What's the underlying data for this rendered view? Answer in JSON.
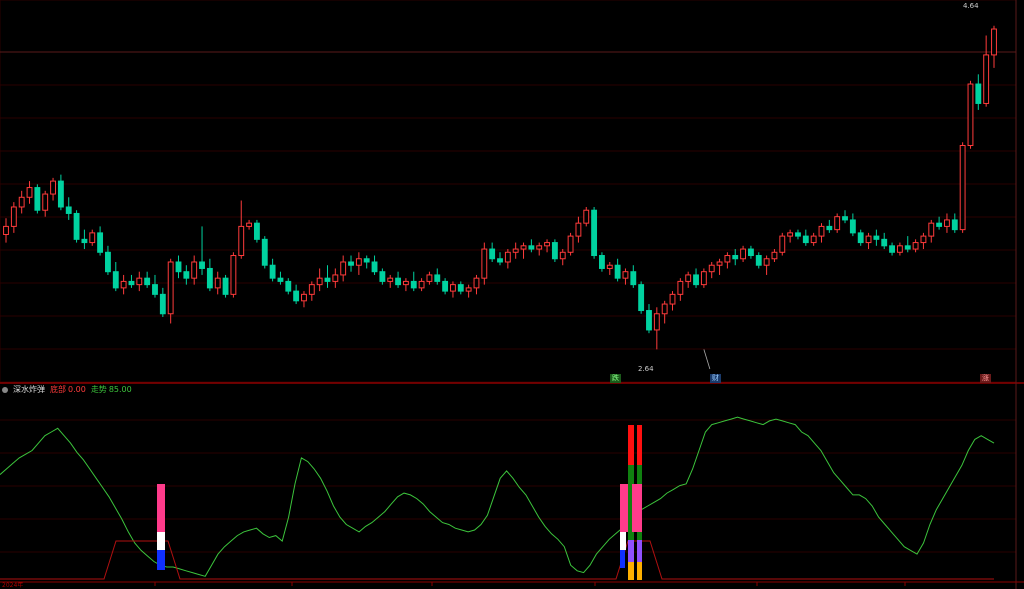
{
  "indicator": {
    "name": "深水炸弹",
    "param1_label": "底部",
    "param1_value": "0.00",
    "param2_label": "走势",
    "param2_value": "85.00"
  },
  "markers": {
    "die": "跌",
    "cai": "财",
    "zhang": "涨"
  },
  "x_axis_label": "2024年",
  "colors": {
    "up": "#ff3b3b",
    "down": "#00d2a0",
    "indicator_line": "#3cc43c",
    "panel_line": "#8b0000"
  },
  "chart_data": [
    {
      "type": "candlestick",
      "title": "",
      "annotations": [
        {
          "label": "4.64",
          "value": 4.64,
          "bar_index": 140
        },
        {
          "label": "2.64",
          "value": 2.64,
          "bar_index": 89
        }
      ],
      "ylim": [
        2.5,
        4.75
      ],
      "candles": [
        [
          3.35,
          3.45,
          3.3,
          3.4
        ],
        [
          3.4,
          3.55,
          3.36,
          3.52
        ],
        [
          3.52,
          3.62,
          3.48,
          3.58
        ],
        [
          3.58,
          3.68,
          3.54,
          3.64
        ],
        [
          3.64,
          3.66,
          3.48,
          3.5
        ],
        [
          3.5,
          3.62,
          3.46,
          3.6
        ],
        [
          3.6,
          3.7,
          3.56,
          3.68
        ],
        [
          3.68,
          3.72,
          3.5,
          3.52
        ],
        [
          3.52,
          3.58,
          3.44,
          3.48
        ],
        [
          3.48,
          3.5,
          3.3,
          3.32
        ],
        [
          3.32,
          3.38,
          3.26,
          3.3
        ],
        [
          3.3,
          3.38,
          3.28,
          3.36
        ],
        [
          3.36,
          3.4,
          3.22,
          3.24
        ],
        [
          3.24,
          3.28,
          3.1,
          3.12
        ],
        [
          3.12,
          3.18,
          3.0,
          3.02
        ],
        [
          3.02,
          3.1,
          2.98,
          3.06
        ],
        [
          3.06,
          3.1,
          3.02,
          3.04
        ],
        [
          3.04,
          3.12,
          3.0,
          3.08
        ],
        [
          3.08,
          3.12,
          3.02,
          3.04
        ],
        [
          3.04,
          3.1,
          2.96,
          2.98
        ],
        [
          2.98,
          3.02,
          2.84,
          2.86
        ],
        [
          2.86,
          3.2,
          2.8,
          3.18
        ],
        [
          3.18,
          3.22,
          3.08,
          3.12
        ],
        [
          3.12,
          3.16,
          3.04,
          3.08
        ],
        [
          3.08,
          3.22,
          3.04,
          3.18
        ],
        [
          3.18,
          3.4,
          3.1,
          3.14
        ],
        [
          3.14,
          3.2,
          3.0,
          3.02
        ],
        [
          3.02,
          3.12,
          2.98,
          3.08
        ],
        [
          3.08,
          3.1,
          2.96,
          2.98
        ],
        [
          2.98,
          3.24,
          2.96,
          3.22
        ],
        [
          3.22,
          3.56,
          3.2,
          3.4
        ],
        [
          3.4,
          3.44,
          3.38,
          3.42
        ],
        [
          3.42,
          3.44,
          3.3,
          3.32
        ],
        [
          3.32,
          3.34,
          3.14,
          3.16
        ],
        [
          3.16,
          3.2,
          3.06,
          3.08
        ],
        [
          3.08,
          3.12,
          3.04,
          3.06
        ],
        [
          3.06,
          3.08,
          2.98,
          3.0
        ],
        [
          3.0,
          3.04,
          2.92,
          2.94
        ],
        [
          2.94,
          3.0,
          2.9,
          2.98
        ],
        [
          2.98,
          3.06,
          2.94,
          3.04
        ],
        [
          3.04,
          3.14,
          3.0,
          3.08
        ],
        [
          3.08,
          3.16,
          3.02,
          3.06
        ],
        [
          3.06,
          3.14,
          3.02,
          3.1
        ],
        [
          3.1,
          3.22,
          3.06,
          3.18
        ],
        [
          3.18,
          3.22,
          3.12,
          3.16
        ],
        [
          3.16,
          3.24,
          3.1,
          3.2
        ],
        [
          3.2,
          3.22,
          3.14,
          3.18
        ],
        [
          3.18,
          3.22,
          3.1,
          3.12
        ],
        [
          3.12,
          3.14,
          3.04,
          3.06
        ],
        [
          3.06,
          3.1,
          3.02,
          3.08
        ],
        [
          3.08,
          3.12,
          3.02,
          3.04
        ],
        [
          3.04,
          3.08,
          3.0,
          3.06
        ],
        [
          3.06,
          3.12,
          3.0,
          3.02
        ],
        [
          3.02,
          3.08,
          3.0,
          3.06
        ],
        [
          3.06,
          3.12,
          3.04,
          3.1
        ],
        [
          3.1,
          3.14,
          3.04,
          3.06
        ],
        [
          3.06,
          3.08,
          2.98,
          3.0
        ],
        [
          3.0,
          3.06,
          2.96,
          3.04
        ],
        [
          3.04,
          3.06,
          2.98,
          3.0
        ],
        [
          3.0,
          3.04,
          2.96,
          3.02
        ],
        [
          3.02,
          3.1,
          2.98,
          3.08
        ],
        [
          3.08,
          3.3,
          3.04,
          3.26
        ],
        [
          3.26,
          3.3,
          3.18,
          3.2
        ],
        [
          3.2,
          3.24,
          3.16,
          3.18
        ],
        [
          3.18,
          3.26,
          3.14,
          3.24
        ],
        [
          3.24,
          3.3,
          3.2,
          3.26
        ],
        [
          3.26,
          3.3,
          3.2,
          3.28
        ],
        [
          3.28,
          3.32,
          3.24,
          3.26
        ],
        [
          3.26,
          3.3,
          3.22,
          3.28
        ],
        [
          3.28,
          3.32,
          3.24,
          3.3
        ],
        [
          3.3,
          3.32,
          3.18,
          3.2
        ],
        [
          3.2,
          3.26,
          3.16,
          3.24
        ],
        [
          3.24,
          3.36,
          3.22,
          3.34
        ],
        [
          3.34,
          3.46,
          3.3,
          3.42
        ],
        [
          3.42,
          3.52,
          3.4,
          3.5
        ],
        [
          3.5,
          3.52,
          3.2,
          3.22
        ],
        [
          3.22,
          3.24,
          3.12,
          3.14
        ],
        [
          3.14,
          3.18,
          3.1,
          3.16
        ],
        [
          3.16,
          3.2,
          3.06,
          3.08
        ],
        [
          3.08,
          3.14,
          3.04,
          3.12
        ],
        [
          3.12,
          3.16,
          3.02,
          3.04
        ],
        [
          3.04,
          3.06,
          2.86,
          2.88
        ],
        [
          2.88,
          2.92,
          2.74,
          2.76
        ],
        [
          2.76,
          2.9,
          2.64,
          2.86
        ],
        [
          2.86,
          2.94,
          2.8,
          2.92
        ],
        [
          2.92,
          3.0,
          2.88,
          2.98
        ],
        [
          2.98,
          3.08,
          2.94,
          3.06
        ],
        [
          3.06,
          3.12,
          3.02,
          3.1
        ],
        [
          3.1,
          3.14,
          3.02,
          3.04
        ],
        [
          3.04,
          3.14,
          3.02,
          3.12
        ],
        [
          3.12,
          3.18,
          3.08,
          3.16
        ],
        [
          3.16,
          3.2,
          3.1,
          3.18
        ],
        [
          3.18,
          3.24,
          3.14,
          3.22
        ],
        [
          3.22,
          3.26,
          3.16,
          3.2
        ],
        [
          3.2,
          3.28,
          3.18,
          3.26
        ],
        [
          3.26,
          3.28,
          3.2,
          3.22
        ],
        [
          3.22,
          3.24,
          3.14,
          3.16
        ],
        [
          3.16,
          3.22,
          3.1,
          3.2
        ],
        [
          3.2,
          3.26,
          3.18,
          3.24
        ],
        [
          3.24,
          3.36,
          3.22,
          3.34
        ],
        [
          3.34,
          3.38,
          3.3,
          3.36
        ],
        [
          3.36,
          3.38,
          3.32,
          3.34
        ],
        [
          3.34,
          3.38,
          3.28,
          3.3
        ],
        [
          3.3,
          3.36,
          3.28,
          3.34
        ],
        [
          3.34,
          3.42,
          3.3,
          3.4
        ],
        [
          3.4,
          3.44,
          3.36,
          3.38
        ],
        [
          3.38,
          3.48,
          3.36,
          3.46
        ],
        [
          3.46,
          3.5,
          3.42,
          3.44
        ],
        [
          3.44,
          3.48,
          3.34,
          3.36
        ],
        [
          3.36,
          3.38,
          3.28,
          3.3
        ],
        [
          3.3,
          3.36,
          3.26,
          3.34
        ],
        [
          3.34,
          3.38,
          3.28,
          3.32
        ],
        [
          3.32,
          3.36,
          3.26,
          3.28
        ],
        [
          3.28,
          3.3,
          3.22,
          3.24
        ],
        [
          3.24,
          3.3,
          3.22,
          3.28
        ],
        [
          3.28,
          3.34,
          3.24,
          3.26
        ],
        [
          3.26,
          3.32,
          3.24,
          3.3
        ],
        [
          3.3,
          3.36,
          3.26,
          3.34
        ],
        [
          3.34,
          3.44,
          3.3,
          3.42
        ],
        [
          3.42,
          3.46,
          3.38,
          3.4
        ],
        [
          3.4,
          3.48,
          3.36,
          3.44
        ],
        [
          3.44,
          3.48,
          3.36,
          3.38
        ],
        [
          3.38,
          3.92,
          3.36,
          3.9
        ],
        [
          3.9,
          4.3,
          3.88,
          4.28
        ],
        [
          4.28,
          4.34,
          4.12,
          4.16
        ],
        [
          4.16,
          4.58,
          4.14,
          4.46
        ],
        [
          4.46,
          4.64,
          4.38,
          4.62
        ]
      ]
    },
    {
      "type": "line",
      "title": "",
      "ylim": [
        0,
        100
      ],
      "series": [
        {
          "name": "走势",
          "values": [
            57,
            60,
            63,
            66,
            68,
            70,
            74,
            78,
            80,
            82,
            78,
            74,
            69,
            65,
            60,
            55,
            50,
            45,
            39,
            33,
            26,
            20,
            16,
            13,
            10,
            8,
            7,
            7,
            6,
            5,
            4,
            3,
            2,
            8,
            14,
            18,
            21,
            24,
            26,
            27,
            28,
            25,
            23,
            24,
            21,
            34,
            52,
            66,
            64,
            60,
            55,
            48,
            40,
            34,
            30,
            28,
            26,
            29,
            31,
            34,
            37,
            41,
            45,
            47,
            46,
            44,
            41,
            37,
            34,
            31,
            30,
            28,
            27,
            26,
            27,
            30,
            35,
            45,
            55,
            59,
            55,
            50,
            46,
            40,
            34,
            29,
            25,
            22,
            18,
            8,
            5,
            4,
            8,
            14,
            18,
            22,
            25,
            28,
            31,
            34,
            38,
            40,
            42,
            44,
            47,
            49,
            51,
            52,
            60,
            70,
            80,
            84,
            85,
            86,
            87,
            88,
            87,
            86,
            85,
            84,
            86,
            87,
            86,
            85,
            84,
            80,
            78,
            74,
            70,
            64,
            58,
            54,
            50,
            46,
            46,
            44,
            40,
            34,
            30,
            26,
            22,
            18,
            16,
            14,
            20,
            30,
            38,
            44,
            50,
            56,
            62,
            70,
            76,
            78,
            76,
            74
          ]
        }
      ]
    }
  ]
}
